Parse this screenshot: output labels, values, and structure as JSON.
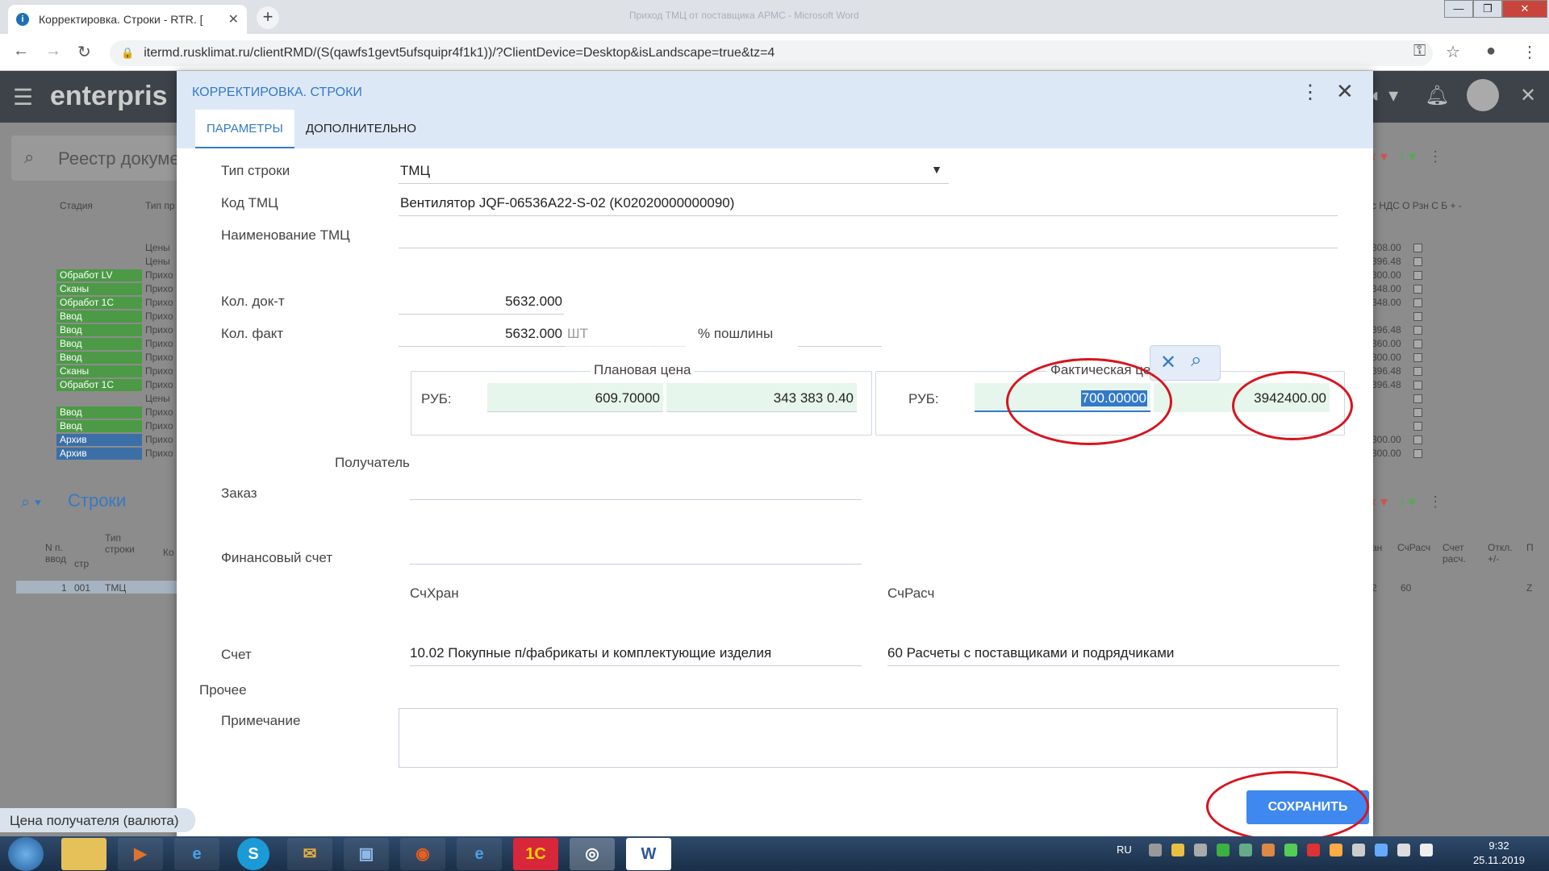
{
  "browser": {
    "tab_title": "Корректировка. Строки - RTR. [",
    "window_title": "Приход ТМЦ от поставщика АРМС - Microsoft Word",
    "url": "itermd.rusklimat.ru/clientRMD/(S(qawfs1gevt5ufsquipr4f1k1))/?ClientDevice=Desktop&isLandscape=true&tz=4"
  },
  "app": {
    "logo_text": "enterpris",
    "registry_title": "Реестр докуме",
    "header_stage": "Стадия",
    "header_type": "Тип пр",
    "strings_title": "Строки",
    "rows_header_n": "N п. ввод",
    "rows_header_str": "стр",
    "rows_header_type": "Тип строки",
    "rows_header_ko": "Ко",
    "row1": {
      "n": "1",
      "str": "001",
      "type": "ТМЦ"
    },
    "badges": [
      {
        "label": "",
        "kind": "none"
      },
      {
        "label": "",
        "kind": "none"
      },
      {
        "label": "Обработ LV",
        "kind": "green"
      },
      {
        "label": "Сканы",
        "kind": "green"
      },
      {
        "label": "Обработ 1С",
        "kind": "green"
      },
      {
        "label": "Ввод",
        "kind": "green"
      },
      {
        "label": "Ввод",
        "kind": "green"
      },
      {
        "label": "Ввод",
        "kind": "green"
      },
      {
        "label": "Ввод",
        "kind": "green"
      },
      {
        "label": "Сканы",
        "kind": "green"
      },
      {
        "label": "Обработ 1С",
        "kind": "green"
      },
      {
        "label": "",
        "kind": "none"
      },
      {
        "label": "Ввод",
        "kind": "green"
      },
      {
        "label": "Ввод",
        "kind": "green"
      },
      {
        "label": "Архив",
        "kind": "blue"
      },
      {
        "label": "Архив",
        "kind": "blue"
      }
    ],
    "types": [
      "Цены",
      "Цены",
      "Прихо",
      "Прихо",
      "Прихо",
      "Прихо",
      "Прихо",
      "Прихо",
      "Прихо",
      "Прихо",
      "Прихо",
      "Цены",
      "Прихо",
      "Прихо",
      "Прихо",
      "Прихо"
    ],
    "right_cols_header": "с НДС  О  Рзн  С  Б  +  -",
    "right_values": [
      "308.00",
      "396.48",
      "300.00",
      "348.00",
      "348.00",
      "",
      "396.48",
      "360.00",
      "300.00",
      "396.48",
      "396.48",
      "",
      "",
      "",
      "300.00",
      "300.00"
    ],
    "right_hdr2": [
      "ан",
      "СчРасч",
      "Счет расч.",
      "Откл. +/-",
      "П"
    ],
    "right_row2": [
      "2",
      "60",
      "",
      "",
      "Z"
    ]
  },
  "dialog": {
    "title": "КОРРЕКТИРОВКА. СТРОКИ",
    "tabs": [
      "ПАРАМЕТРЫ",
      "ДОПОЛНИТЕЛЬНО"
    ],
    "fields": {
      "type_label": "Тип строки",
      "type_value": "ТМЦ",
      "code_label": "Код ТМЦ",
      "code_value": "Вентилятор JQF-06536A22-S-02 (K02020000000090)",
      "name_label": "Наименование ТМЦ",
      "name_value": "",
      "qty_doc_label": "Кол. док-т",
      "qty_doc_value": "5632.000",
      "qty_fact_label": "Кол. факт",
      "qty_fact_value": "5632.000",
      "unit": "ШТ",
      "duty_label": "% пошлины",
      "duty_value": ""
    },
    "plan_price": {
      "title": "Плановая цена",
      "currency": "РУБ:",
      "price": "609.70000",
      "total": "343 383 0.40"
    },
    "fact_price": {
      "title": "Фактическая цена",
      "currency": "РУБ:",
      "price": "700.00000",
      "total": "3942400.00"
    },
    "receiver_label": "Получатель",
    "order_label": "Заказ",
    "fin_account_label": "Финансовый счет",
    "sch_hran_label": "СчХран",
    "sch_rasch_label": "СчРасч",
    "account_label": "Счет",
    "sch_hran_value": "10.02 Покупные п/фабрикаты и комплектующие изделия",
    "sch_rasch_value": "60 Расчеты с поставщиками и подрядчиками",
    "other_label": "Прочее",
    "note_label": "Примечание",
    "save_label": "СОХРАНИТЬ"
  },
  "tooltip": "Цена получателя (валюта)",
  "taskbar": {
    "lang": "RU",
    "time": "9:32",
    "date": "25.11.2019"
  },
  "colors": {
    "accent": "#3479c8",
    "save_button": "#3f88f0",
    "highlight_circle": "#d8141e",
    "green_field": "#e7f6ec"
  }
}
